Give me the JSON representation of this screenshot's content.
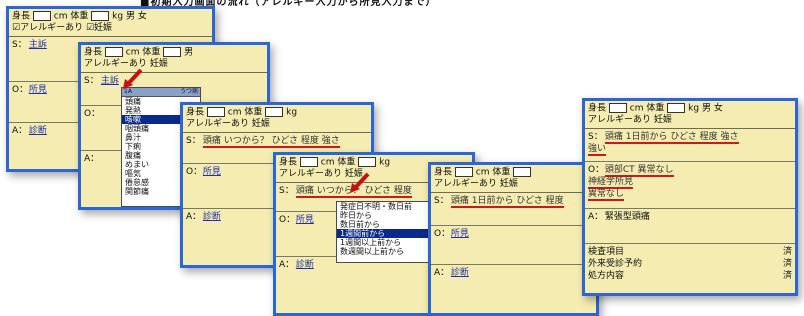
{
  "caption_strip": "■初期入力画面の流れ（アレルギー入力から所見入力まで）",
  "header": {
    "height_label": "身長",
    "height_unit": "cm",
    "weight_label": "体重",
    "weight_unit": "kg",
    "sex_male": "男",
    "sex_female": "女",
    "allergy_label": "アレルギー",
    "allergy_value": "あり",
    "pregnancy_label": "妊娠",
    "allergy_short": "アレルギーあり"
  },
  "soap": {
    "s_label": "S：",
    "o_label": "O：",
    "a_label": "A：",
    "s_link": "主訴",
    "o_link": "所見",
    "a_link": "診断"
  },
  "panel2_dropdown": {
    "header_left": "1A",
    "header_right": "うつ病",
    "items": [
      "頭痛",
      "発熱",
      "咳嗽",
      "咽頭痛",
      "鼻汁",
      "下痢",
      "腹痛",
      "めまい",
      "嘔気",
      "倦怠感",
      "関節痛"
    ],
    "selected_index": 2
  },
  "panel3": {
    "s_text": "頭痛 いつから？ ひどさ 程度 強さ"
  },
  "panel4": {
    "s_text": "頭痛 いつから？ ひどさ 程度",
    "dropdown_items": [
      "発症日不明・数日前",
      "昨日から",
      "数日前から",
      "1週間前から",
      "1週間以上前から",
      "数週間以上前から"
    ],
    "selected_index": 3
  },
  "panel5": {
    "s_text": "頭痛 1日前から ひどさ 程度"
  },
  "panel6": {
    "s_text": "頭痛 1日前から ひどさ 程度 強さ",
    "s_text2": "強い",
    "o_text": "頭部CT 異常なし",
    "o_text2": "神経学所見",
    "o_text3": "異常なし",
    "a_text": "緊張型頭痛",
    "footer_items": [
      {
        "label": "検査項目",
        "value": "済"
      },
      {
        "label": "外来受診予約",
        "value": "済"
      },
      {
        "label": "処方内容",
        "value": "済"
      }
    ]
  }
}
